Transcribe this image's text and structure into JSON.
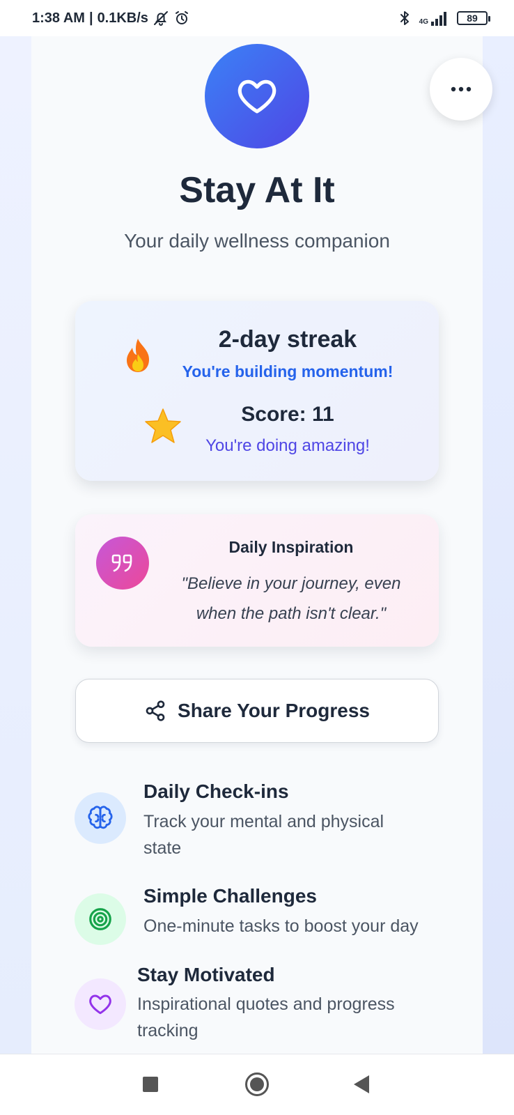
{
  "status_bar": {
    "time": "1:38 AM",
    "speed": "0.1KB/s",
    "network": "4G",
    "battery": "89"
  },
  "app": {
    "title": "Stay At It",
    "subtitle": "Your daily wellness companion"
  },
  "streak_card": {
    "streak_title": "2-day streak",
    "streak_message": "You're building momentum!",
    "score_title": "Score: 11",
    "score_message": "You're doing amazing!"
  },
  "inspiration": {
    "title": "Daily Inspiration",
    "quote_line1": "\"Believe in your journey, even",
    "quote_line2": "when the path isn't clear.\""
  },
  "share_button": {
    "label": "Share Your Progress"
  },
  "features": [
    {
      "title": "Daily Check-ins",
      "desc_line1": "Track your mental and physical",
      "desc_line2": "state",
      "icon": "brain-icon",
      "color": "#2563eb",
      "bg": "#dbeafe"
    },
    {
      "title": "Simple Challenges",
      "desc_line1": "One-minute tasks to boost your day",
      "desc_line2": "",
      "icon": "target-icon",
      "color": "#16a34a",
      "bg": "#dcfce7"
    },
    {
      "title": "Stay Motivated",
      "desc_line1": "Inspirational quotes and progress",
      "desc_line2": "tracking",
      "icon": "heart-icon",
      "color": "#9333ea",
      "bg": "#f3e8ff"
    }
  ],
  "colors": {
    "primary_blue": "#3b82f6",
    "indigo": "#4f46e5",
    "pink": "#ec4899",
    "text_dark": "#1e293b"
  }
}
